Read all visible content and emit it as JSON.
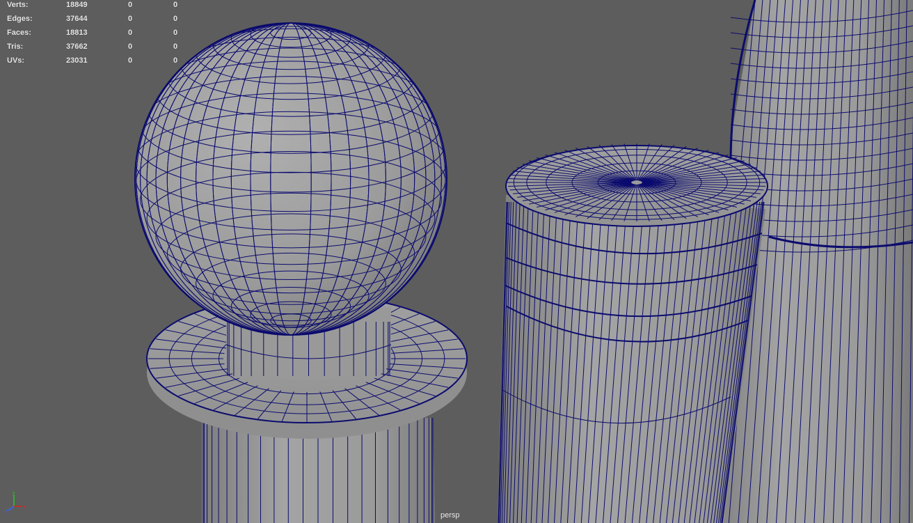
{
  "stats": [
    {
      "label": "Verts:",
      "total": "18849",
      "selected": "0",
      "component": "0"
    },
    {
      "label": "Edges:",
      "total": "37644",
      "selected": "0",
      "component": "0"
    },
    {
      "label": "Faces:",
      "total": "18813",
      "selected": "0",
      "component": "0"
    },
    {
      "label": "Tris:",
      "total": "37662",
      "selected": "0",
      "component": "0"
    },
    {
      "label": "UVs:",
      "total": "23031",
      "selected": "0",
      "component": "0"
    }
  ],
  "camera": {
    "name": "persp"
  },
  "axis": {
    "y": "y",
    "x": "x",
    "z": "z"
  },
  "colors": {
    "background": "#5d5d5d",
    "mesh_fill": "#9a9a9a",
    "wire": "#0b0b6e",
    "hud_text": "#e6e6e6",
    "axis_x": "#d22",
    "axis_y": "#2c2",
    "axis_z": "#36f"
  }
}
